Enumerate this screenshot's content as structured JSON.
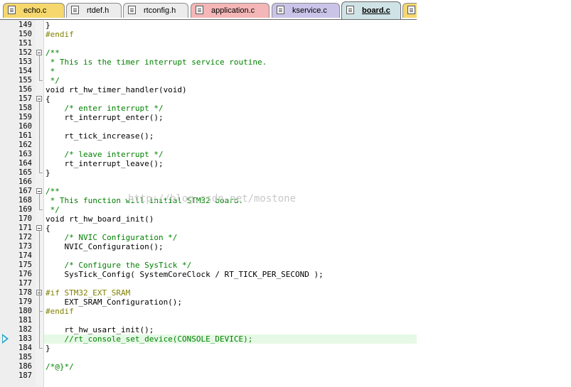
{
  "tabs": [
    {
      "label": "echo.c",
      "color": "#f5d76e"
    },
    {
      "label": "rtdef.h",
      "color": "#ececec"
    },
    {
      "label": "rtconfig.h",
      "color": "#ececec"
    },
    {
      "label": "application.c",
      "color": "#f4b6b6"
    },
    {
      "label": "kservice.c",
      "color": "#c9c4e8"
    },
    {
      "label": "board.c",
      "color": "#cfe3e6",
      "active": true
    },
    {
      "label": "",
      "color": "#f5d76e"
    }
  ],
  "editor": {
    "watermark": "http://blog.csdn.net/mostone",
    "highlight_color": "#e6f9e6",
    "current_line": "183",
    "lines": [
      {
        "n": "149",
        "text": "}"
      },
      {
        "n": "150",
        "text": "#endif"
      },
      {
        "n": "151",
        "text": ""
      },
      {
        "n": "152",
        "text": "/**"
      },
      {
        "n": "153",
        "text": " * This is the timer interrupt service routine."
      },
      {
        "n": "154",
        "text": " *"
      },
      {
        "n": "155",
        "text": " */"
      },
      {
        "n": "156",
        "text": "void rt_hw_timer_handler(void)"
      },
      {
        "n": "157",
        "text": "{"
      },
      {
        "n": "158",
        "text": "    /* enter interrupt */"
      },
      {
        "n": "159",
        "text": "    rt_interrupt_enter();"
      },
      {
        "n": "160",
        "text": ""
      },
      {
        "n": "161",
        "text": "    rt_tick_increase();"
      },
      {
        "n": "162",
        "text": ""
      },
      {
        "n": "163",
        "text": "    /* leave interrupt */"
      },
      {
        "n": "164",
        "text": "    rt_interrupt_leave();"
      },
      {
        "n": "165",
        "text": "}"
      },
      {
        "n": "166",
        "text": ""
      },
      {
        "n": "167",
        "text": "/**"
      },
      {
        "n": "168",
        "text": " * This function will initial STM32 board."
      },
      {
        "n": "169",
        "text": " */"
      },
      {
        "n": "170",
        "text": "void rt_hw_board_init()"
      },
      {
        "n": "171",
        "text": "{"
      },
      {
        "n": "172",
        "text": "    /* NVIC Configuration */"
      },
      {
        "n": "173",
        "text": "    NVIC_Configuration();"
      },
      {
        "n": "174",
        "text": ""
      },
      {
        "n": "175",
        "text": "    /* Configure the SysTick */"
      },
      {
        "n": "176",
        "text": "    SysTick_Config( SystemCoreClock / RT_TICK_PER_SECOND );"
      },
      {
        "n": "177",
        "text": ""
      },
      {
        "n": "178",
        "text": "#if STM32_EXT_SRAM"
      },
      {
        "n": "179",
        "text": "    EXT_SRAM_Configuration();"
      },
      {
        "n": "180",
        "text": "#endif"
      },
      {
        "n": "181",
        "text": ""
      },
      {
        "n": "182",
        "text": "    rt_hw_usart_init();"
      },
      {
        "n": "183",
        "text": "    //rt_console_set_device(CONSOLE_DEVICE);"
      },
      {
        "n": "184",
        "text": "}"
      },
      {
        "n": "185",
        "text": ""
      },
      {
        "n": "186",
        "text": "/*@}*/"
      },
      {
        "n": "187",
        "text": ""
      }
    ]
  }
}
